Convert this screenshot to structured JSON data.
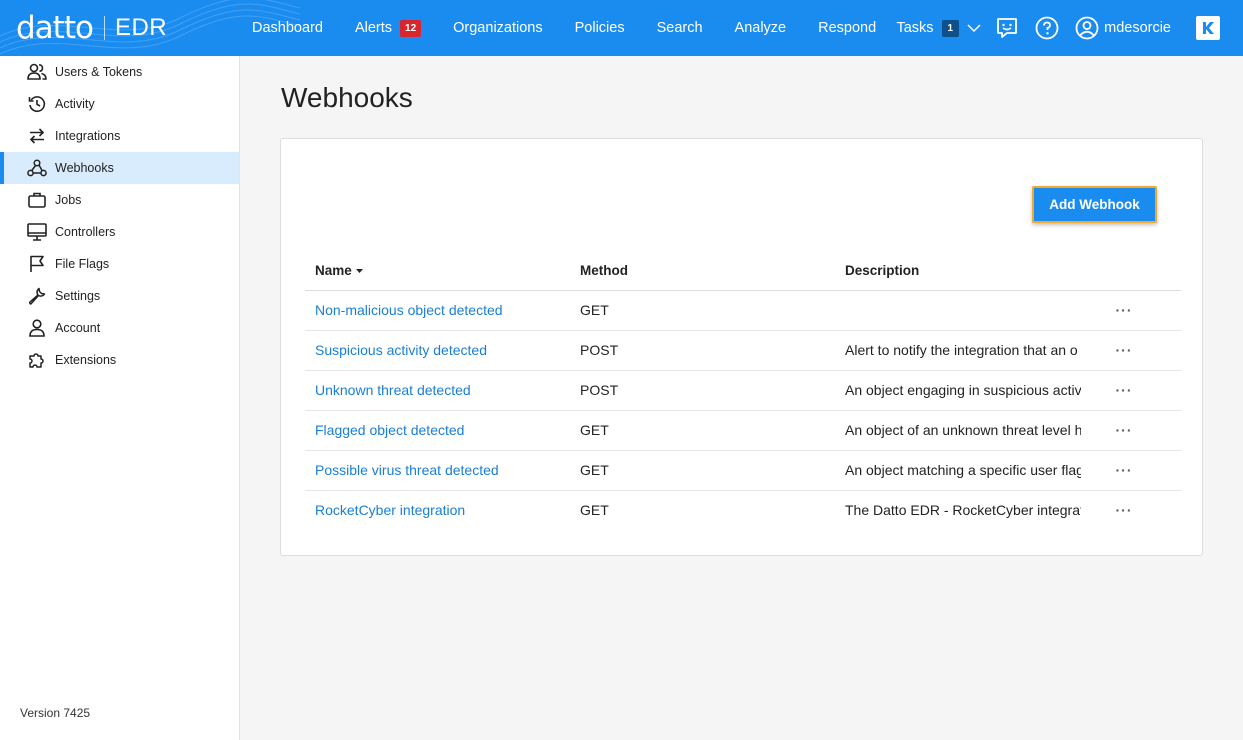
{
  "brand": {
    "logo": "datto",
    "product": "EDR"
  },
  "nav": {
    "items": [
      {
        "label": "Dashboard"
      },
      {
        "label": "Alerts",
        "badge": "12"
      },
      {
        "label": "Organizations"
      },
      {
        "label": "Policies"
      },
      {
        "label": "Search"
      },
      {
        "label": "Analyze"
      },
      {
        "label": "Respond"
      }
    ],
    "tasks": {
      "label": "Tasks",
      "badge": "1"
    },
    "user": "mdesorcie"
  },
  "sidebar": {
    "items": [
      {
        "label": "Users & Tokens",
        "icon": "users-icon"
      },
      {
        "label": "Activity",
        "icon": "history-icon"
      },
      {
        "label": "Integrations",
        "icon": "swap-arrows-icon"
      },
      {
        "label": "Webhooks",
        "icon": "webhook-icon",
        "active": true
      },
      {
        "label": "Jobs",
        "icon": "briefcase-icon"
      },
      {
        "label": "Controllers",
        "icon": "monitor-icon"
      },
      {
        "label": "File Flags",
        "icon": "flag-icon"
      },
      {
        "label": "Settings",
        "icon": "wrench-icon"
      },
      {
        "label": "Account",
        "icon": "user-icon"
      },
      {
        "label": "Extensions",
        "icon": "puzzle-icon"
      }
    ],
    "version": "Version 7425"
  },
  "main": {
    "title": "Webhooks",
    "add_button": "Add Webhook",
    "columns": {
      "name": "Name",
      "method": "Method",
      "description": "Description"
    },
    "rows": [
      {
        "name": "Non-malicious object detected",
        "method": "GET",
        "description": "",
        "more": "···"
      },
      {
        "name": "Suspicious activity detected",
        "method": "POST",
        "description": "Alert to notify the integration that an o",
        "more": "···"
      },
      {
        "name": "Unknown threat detected",
        "method": "POST",
        "description": "An object engaging in suspicious activ",
        "more": "···"
      },
      {
        "name": "Flagged object detected",
        "method": "GET",
        "description": "An object of an unknown threat level h",
        "more": "···"
      },
      {
        "name": "Possible virus threat detected",
        "method": "GET",
        "description": "An object matching a specific user flag",
        "more": "···"
      },
      {
        "name": "RocketCyber integration",
        "method": "GET",
        "description": "The Datto EDR - RocketCyber integrati",
        "more": "···"
      }
    ]
  },
  "colors": {
    "accent": "#1a8cf0",
    "alert_badge": "#d9262e",
    "link": "#1a7fd4",
    "active_bg": "#d9ecfd",
    "highlight": "#f0a830"
  }
}
